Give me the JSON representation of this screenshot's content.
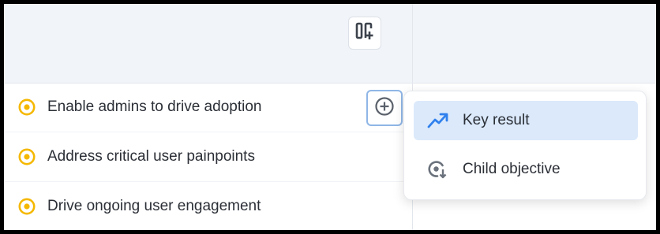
{
  "toolbar": {
    "column_toggle_icon": "columns-add-icon"
  },
  "objectives": [
    {
      "label": "Enable admins to drive adoption",
      "status_icon": "status-circle-icon",
      "status_color": "#f5b800"
    },
    {
      "label": "Address critical user painpoints",
      "status_icon": "status-circle-icon",
      "status_color": "#f5b800"
    },
    {
      "label": "Drive ongoing user engagement",
      "status_icon": "status-circle-icon",
      "status_color": "#f5b800"
    }
  ],
  "add_button": {
    "icon": "plus-circle-icon"
  },
  "add_menu": {
    "items": [
      {
        "label": "Key result",
        "icon": "trend-up-icon",
        "highlighted": true
      },
      {
        "label": "Child objective",
        "icon": "child-objective-icon",
        "highlighted": false
      }
    ]
  },
  "colors": {
    "accent_blue": "#2f80ed",
    "status_yellow": "#f5b800",
    "header_bg": "#f1f4f8",
    "menu_highlight": "#dbe9fb"
  }
}
